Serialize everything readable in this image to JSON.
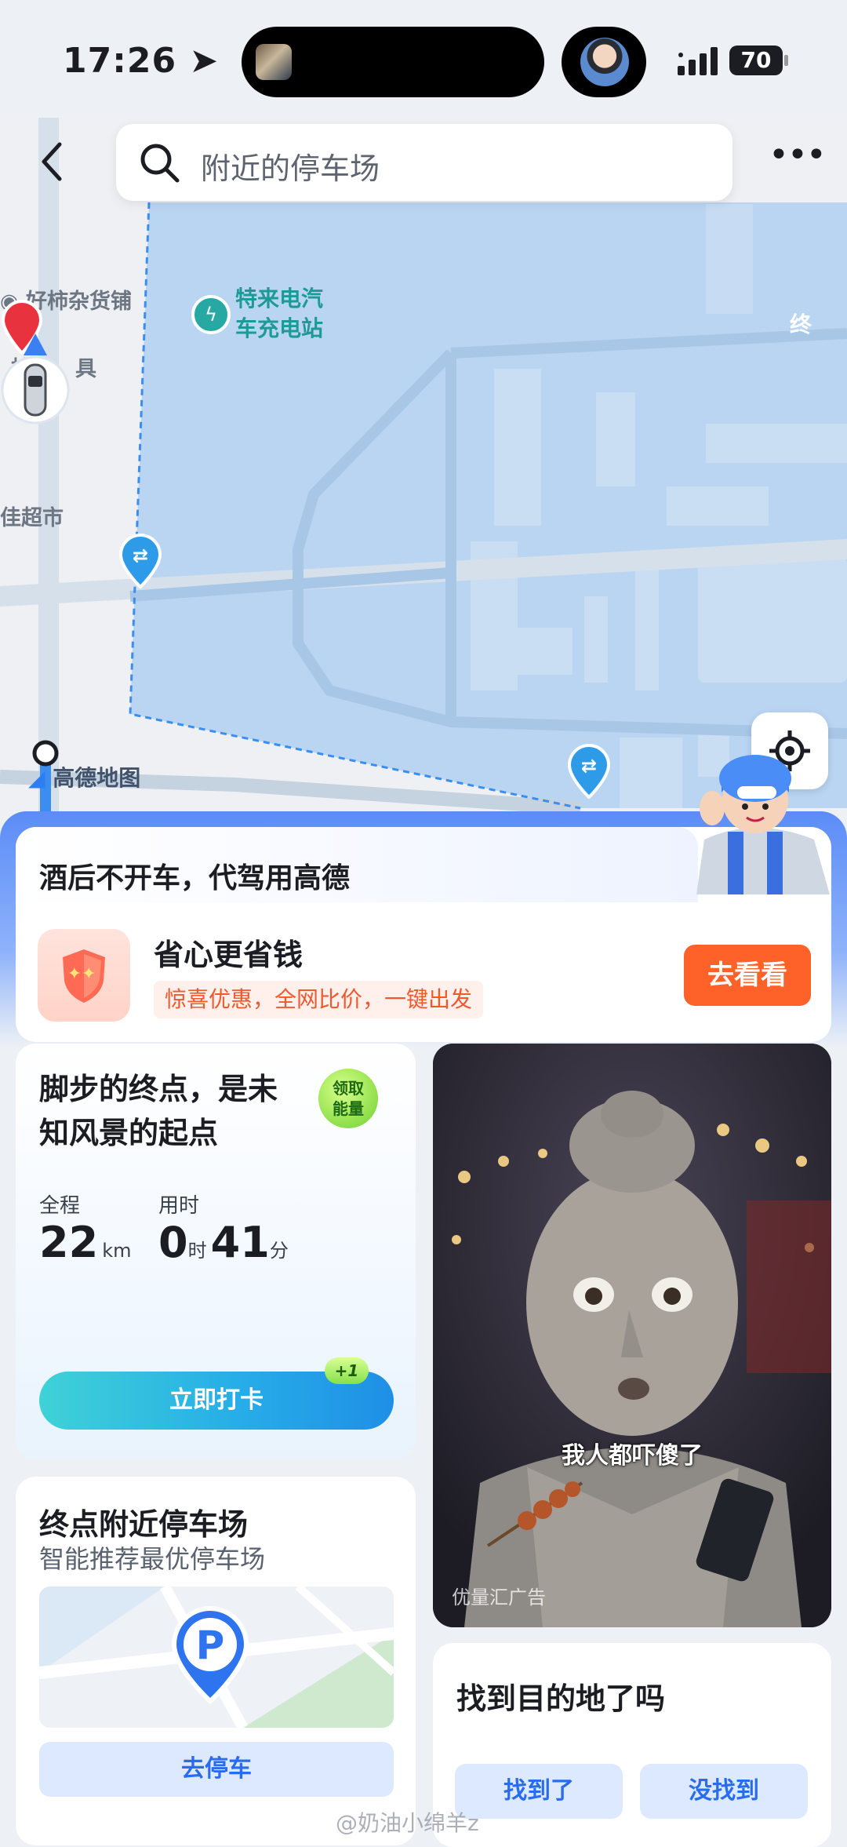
{
  "status_bar": {
    "time": "17:26",
    "battery": "70"
  },
  "map": {
    "search_placeholder": "附近的停车场",
    "pois": [
      "好柿杂货铺",
      "柏",
      "具",
      "佳超市"
    ],
    "charging_station": [
      "特来电汽",
      "车充电站"
    ],
    "end_marker": "终",
    "logo": "高德地图",
    "colors": {
      "area": "#b9d5f2",
      "route": "#3b8ef0",
      "end": "#e8323e"
    }
  },
  "banner": {
    "title": "酒后不开车，代驾用高德",
    "headline": "省心更省钱",
    "subtitle": "惊喜优惠，全网比价，一键出发",
    "button": "去看看"
  },
  "walk_card": {
    "title": "脚步的终点，是未知风景的起点",
    "badge": "领取能量",
    "distance_label": "全程",
    "distance_value": "22",
    "distance_unit": "km",
    "time_label": "用时",
    "hours": "0",
    "hours_unit": "时",
    "minutes": "41",
    "minutes_unit": "分",
    "checkin_button": "立即打卡",
    "checkin_bonus": "+1"
  },
  "video": {
    "caption": "我人都吓傻了",
    "ad_note": "优量汇广告"
  },
  "parking_card": {
    "title": "终点附近停车场",
    "subtitle": "智能推荐最优停车场",
    "pin_letter": "P",
    "button": "去停车"
  },
  "found_card": {
    "title": "找到目的地了吗",
    "yes_button": "找到了",
    "no_button": "没找到"
  },
  "watermark": "@奶油小绵羊z"
}
